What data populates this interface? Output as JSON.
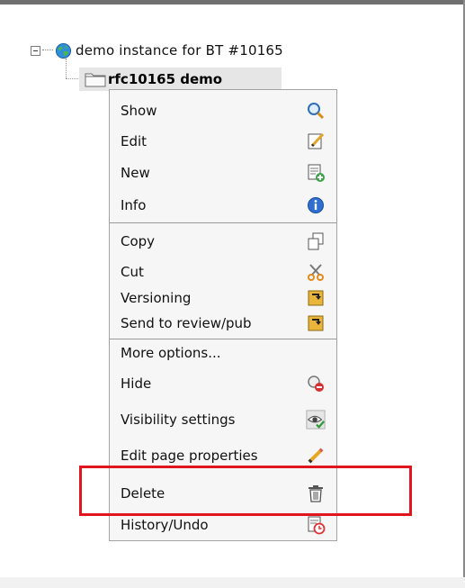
{
  "tree": {
    "root_label": "demo instance for BT #10165",
    "node_label": "rfc10165 demo"
  },
  "menu": {
    "group1": [
      {
        "label": "Show",
        "icon": "magnifier-icon"
      },
      {
        "label": "Edit",
        "icon": "edit-pencil-icon"
      },
      {
        "label": "New",
        "icon": "new-page-icon"
      },
      {
        "label": "Info",
        "icon": "info-icon"
      }
    ],
    "group2": [
      {
        "label": "Copy",
        "icon": "copy-icon"
      },
      {
        "label": "Cut",
        "icon": "scissors-icon"
      },
      {
        "label": "Versioning",
        "icon": "versioning-icon"
      },
      {
        "label": "Send to review/pub",
        "icon": "workflow-icon"
      }
    ],
    "group3": [
      {
        "label": "More options...",
        "icon": ""
      },
      {
        "label": "Hide",
        "icon": "hide-icon"
      },
      {
        "label": "Visibility settings",
        "icon": "visibility-icon"
      },
      {
        "label": "Edit page properties",
        "icon": "pencil-icon"
      },
      {
        "label": "Delete",
        "icon": "trash-icon"
      },
      {
        "label": "History/Undo",
        "icon": "history-icon"
      }
    ]
  },
  "colors": {
    "highlight_border": "#e0151d",
    "menu_background": "#f6f6f6",
    "selected_node_background": "#e6e6e6"
  }
}
